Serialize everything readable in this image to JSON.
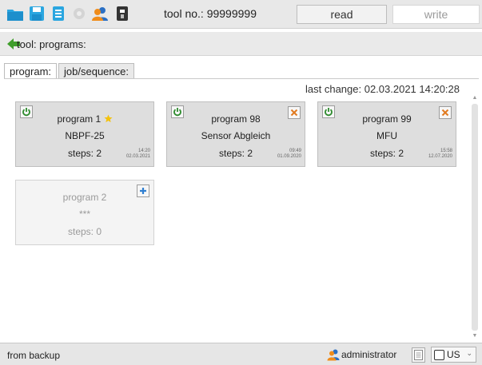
{
  "toolbar": {
    "icons": [
      "folder-icon",
      "save-icon",
      "printer-icon",
      "gear-icon",
      "users-icon",
      "usb-drive-icon"
    ],
    "tool_no_label": "tool no.: 99999999",
    "read_label": "read",
    "write_label": "write"
  },
  "breadcrumb": {
    "text": "tool: programs:"
  },
  "tabs": [
    {
      "label": "program:",
      "active": true
    },
    {
      "label": "job/sequence:",
      "active": false
    }
  ],
  "last_change": "last change:  02.03.2021  14:20:28",
  "programs": [
    {
      "name": "program 1",
      "favorite": true,
      "subtitle": "NBPF-25",
      "steps": "steps: 2",
      "time": "14:20",
      "date": "02.03.2021",
      "deletable": false
    },
    {
      "name": "program 98",
      "favorite": false,
      "subtitle": "Sensor Abgleich",
      "steps": "steps: 2",
      "time": "09:49",
      "date": "01.09.2020",
      "deletable": true
    },
    {
      "name": "program 99",
      "favorite": false,
      "subtitle": "MFU",
      "steps": "steps: 2",
      "time": "15:58",
      "date": "12.07.2020",
      "deletable": true
    }
  ],
  "empty_program": {
    "name": "program 2",
    "subtitle": "***",
    "steps": "steps: 0"
  },
  "status": {
    "text": "from backup",
    "user": "administrator",
    "language": "US"
  },
  "colors": {
    "accent_green": "#2e8b2e",
    "delete_orange": "#e07a1f",
    "add_blue": "#2f7fd1",
    "star_yellow": "#f4c20d"
  }
}
